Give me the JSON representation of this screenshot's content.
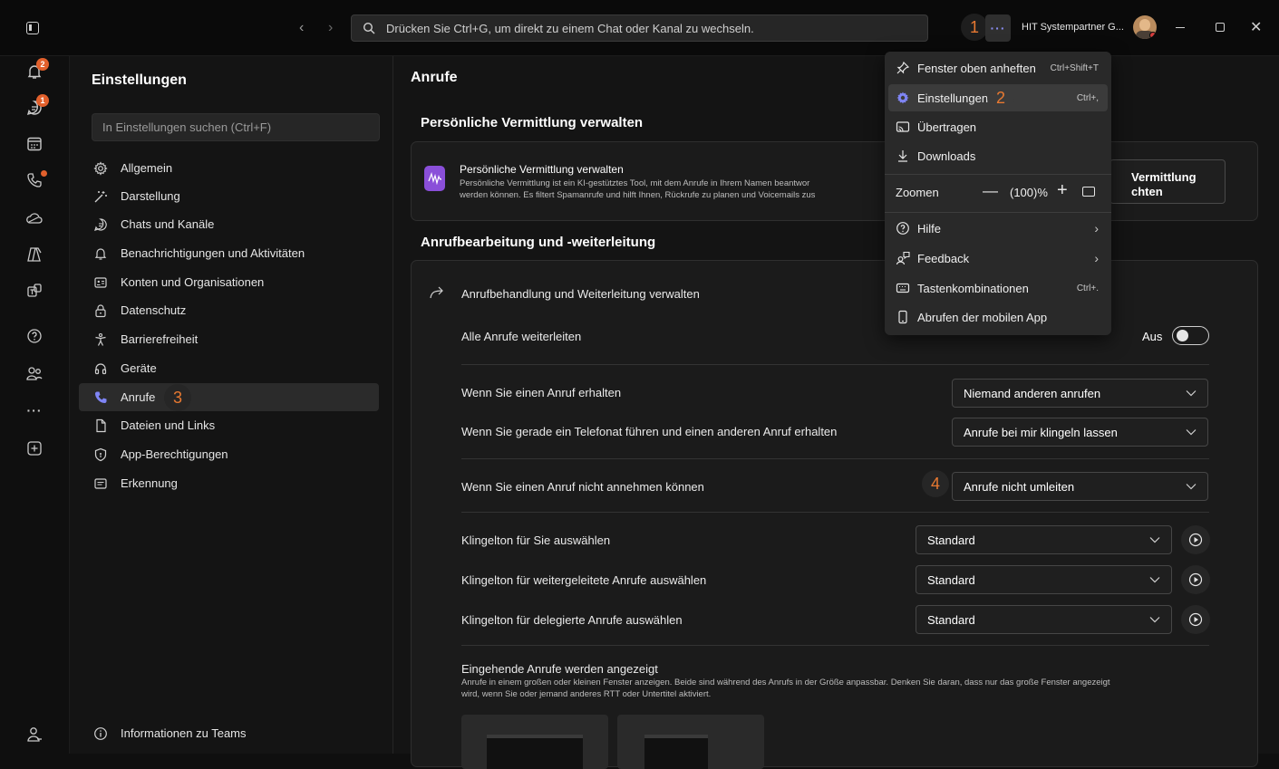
{
  "titlebar": {
    "search_placeholder": "Drücken Sie Ctrl+G, um direkt zu einem Chat oder Kanal zu wechseln.",
    "org_name": "HIT Systempartner G...",
    "marker_1": "1"
  },
  "rail": {
    "activity_badge": "2",
    "chat_badge": "1"
  },
  "nav": {
    "title": "Einstellungen",
    "search_placeholder": "In Einstellungen suchen (Ctrl+F)",
    "items": [
      {
        "label": "Allgemein"
      },
      {
        "label": "Darstellung"
      },
      {
        "label": "Chats und Kanäle"
      },
      {
        "label": "Benachrichtigungen und Aktivitäten"
      },
      {
        "label": "Konten und Organisationen"
      },
      {
        "label": "Datenschutz"
      },
      {
        "label": "Barrierefreiheit"
      },
      {
        "label": "Geräte"
      },
      {
        "label": "Anrufe"
      },
      {
        "label": "Dateien und Links"
      },
      {
        "label": "App-Berechtigungen"
      },
      {
        "label": "Erkennung"
      }
    ],
    "marker_3": "3",
    "about": "Informationen zu Teams"
  },
  "main": {
    "title": "Anrufe",
    "section1_title": "Persönliche Vermittlung verwalten",
    "pv_title": "Persönliche Vermittlung verwalten",
    "pv_desc_line1": "Persönliche Vermittlung ist ein KI-gestütztes Tool, mit dem Anrufe in Ihrem Namen beantwor",
    "pv_desc_line2": "werden können. Es filtert Spamanrufe und hilft Ihnen, Rückrufe zu planen und Voicemails zus",
    "pv_button_line1": "Vermittlung",
    "pv_button_line2": "chten",
    "section2_title": "Anrufbearbeitung und -weiterleitung",
    "manage_forwarding": "Anrufbehandlung und Weiterleitung verwalten",
    "forward_all": "Alle Anrufe weiterleiten",
    "forward_all_state": "Aus",
    "forward_all_on": false,
    "when_receive": "Wenn Sie einen Anruf erhalten",
    "when_receive_value": "Niemand anderen anrufen",
    "when_busy": "Wenn Sie gerade ein Telefonat führen und einen anderen Anruf erhalten",
    "when_busy_value": "Anrufe bei mir klingeln lassen",
    "when_unanswered": "Wenn Sie einen Anruf nicht annehmen können",
    "when_unanswered_value": "Anrufe nicht umleiten",
    "marker_4": "4",
    "ringtone_you": "Klingelton für Sie auswählen",
    "ringtone_you_value": "Standard",
    "ringtone_forwarded": "Klingelton für weitergeleitete Anrufe auswählen",
    "ringtone_forwarded_value": "Standard",
    "ringtone_delegated": "Klingelton für delegierte Anrufe auswählen",
    "ringtone_delegated_value": "Standard",
    "incoming_title": "Eingehende Anrufe werden angezeigt",
    "incoming_desc_line1": "Anrufe in einem großen oder kleinen Fenster anzeigen. Beide sind während des Anrufs in der Größe anpassbar. Denken Sie daran, dass nur das große Fenster angezeigt",
    "incoming_desc_line2": "wird, wenn Sie oder jemand anderes RTT oder Untertitel aktiviert."
  },
  "menu": {
    "pin": "Fenster oben anheften",
    "pin_shortcut": "Ctrl+Shift+T",
    "settings": "Einstellungen",
    "settings_shortcut": "Ctrl+,",
    "marker_2": "2",
    "cast": "Übertragen",
    "downloads": "Downloads",
    "zoom": "Zoomen",
    "zoom_value": "(100)%",
    "help": "Hilfe",
    "feedback": "Feedback",
    "shortcuts": "Tastenkombinationen",
    "shortcuts_shortcut": "Ctrl+.",
    "mobile": "Abrufen der mobilen App"
  },
  "colors": {
    "accent": "#7f85f5",
    "badge": "#e2602c",
    "marker": "#e87931",
    "pv_icon": "#8a4fd9"
  }
}
